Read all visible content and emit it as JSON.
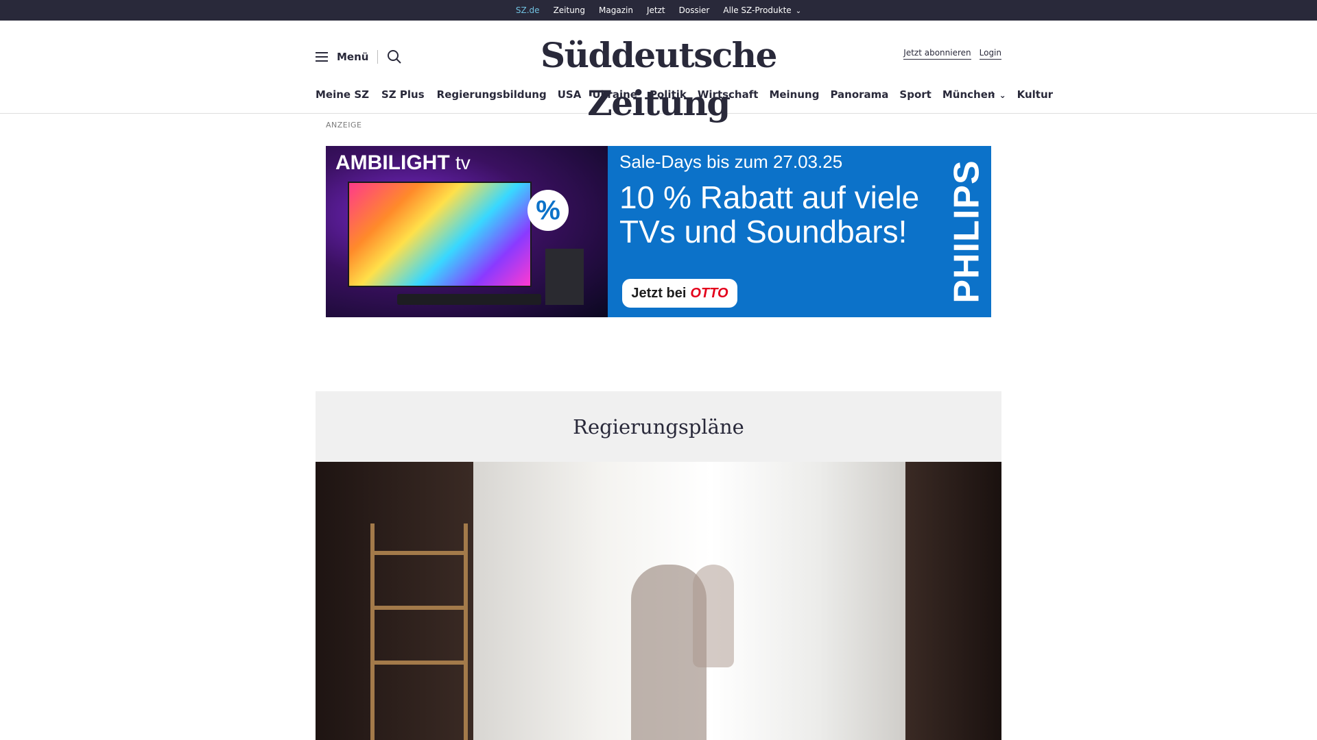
{
  "topbar": {
    "links": [
      "SZ.de",
      "Zeitung",
      "Magazin",
      "Jetzt",
      "Dossier",
      "Alle SZ-Produkte"
    ]
  },
  "header": {
    "menu_label": "Menü",
    "logo": "Süddeutsche Zeitung",
    "subscribe": "Jetzt abonnieren",
    "login": "Login"
  },
  "nav": {
    "items": [
      "Meine SZ",
      "SZ Plus",
      "Regierungsbildung",
      "USA",
      "Ukraine",
      "Politik",
      "Wirtschaft",
      "Meinung",
      "Panorama",
      "Sport",
      "München",
      "Kultur"
    ]
  },
  "ad": {
    "label": "ANZEIGE",
    "brand_main": "AMBILIGHT",
    "brand_tv": "tv",
    "percent": "%",
    "sale": "Sale-Days bis zum 27.03.25",
    "headline": "10 % Rabatt auf viele TVs und Soundbars!",
    "cta_prefix": "Jetzt bei",
    "cta_store": "OTTO",
    "sponsor": "PHILIPS"
  },
  "section": {
    "title": "Regierungspläne"
  },
  "colors": {
    "topbar_bg": "#29293a",
    "active_link": "#71c1e0",
    "ad_blue": "#0c72c9",
    "otto_red": "#e3001b",
    "section_bg": "#f0f0f0"
  }
}
